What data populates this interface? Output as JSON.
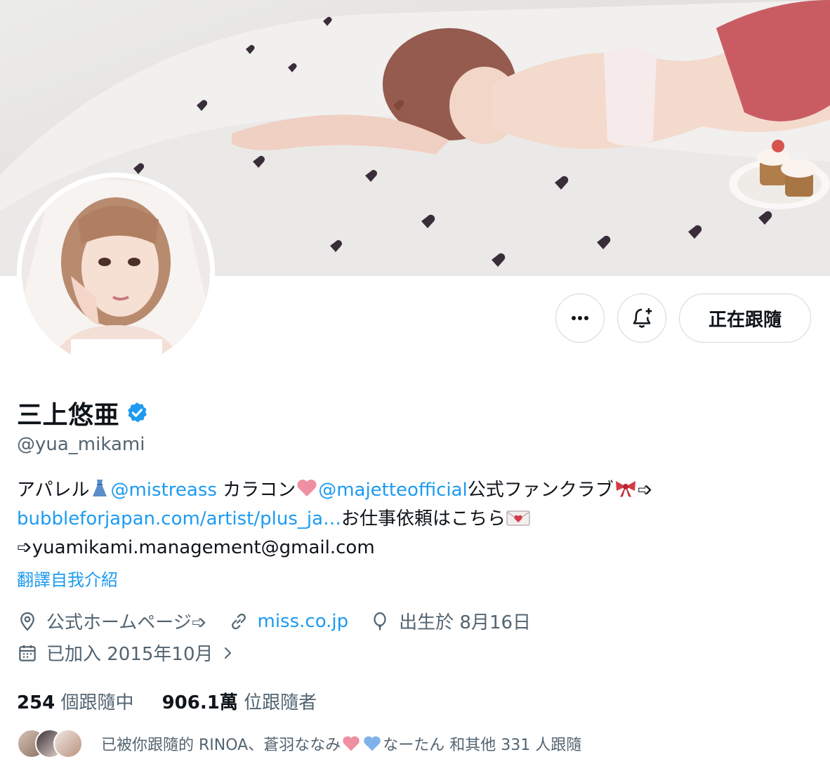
{
  "profile": {
    "display_name": "三上悠亜",
    "handle": "@yua_mikami",
    "verified": true
  },
  "actions": {
    "more_label": "more",
    "notify_label": "notifications",
    "follow_label": "正在跟隨"
  },
  "bio": {
    "t1": "アパレル",
    "m1": "@mistreass",
    "t2": " カラコン",
    "m2": "@majetteofficial",
    "t3": "公式ファンクラブ",
    "t4": "➩",
    "url": "bubbleforjapan.com/artist/plus_ja…",
    "t5": "お仕事依頼はこちら",
    "email": "➩yuamikami.management@gmail.com"
  },
  "translate_label": "翻譯自我介紹",
  "meta": {
    "location": "公式ホームページ➩",
    "website": "miss.co.jp",
    "birthday": "出生於 8月16日",
    "joined": "已加入 2015年10月"
  },
  "stats": {
    "following_count": "254",
    "following_label": "個跟隨中",
    "followers_count": "906.1萬",
    "followers_label": "位跟隨者"
  },
  "followed_by": {
    "text_a": "已被你跟隨的 RINOA、蒼羽ななみ",
    "text_b": "なーたん 和其他 331 人跟隨"
  },
  "colors": {
    "accent": "#1d9bf0",
    "secondary_text": "#536471",
    "primary_text": "#0f1419",
    "border": "#cfd9de"
  },
  "icons": [
    "more-dots-icon",
    "bell-plus-icon",
    "verified-badge-icon",
    "location-icon",
    "link-icon",
    "balloon-icon",
    "calendar-icon",
    "chevron-right-icon",
    "dress-emoji",
    "pink-heart-emoji",
    "ribbon-emoji",
    "love-letter-emoji",
    "blue-heart-emoji"
  ]
}
